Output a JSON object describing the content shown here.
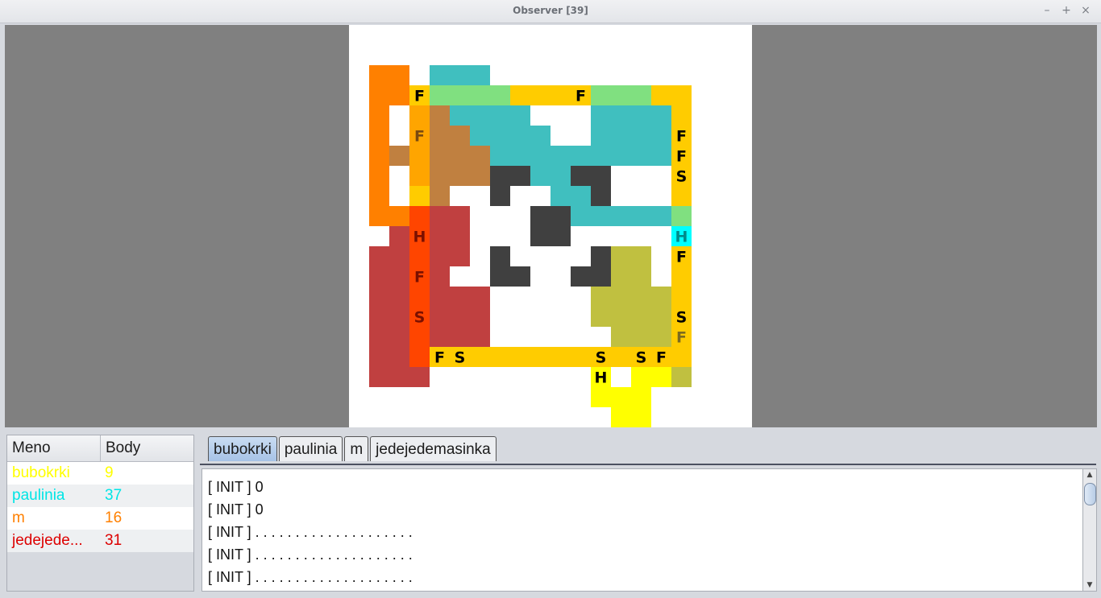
{
  "window": {
    "title": "Observer [39]",
    "buttons": {
      "minimize": "–",
      "maximize": "+",
      "close": "×"
    }
  },
  "scoreboard": {
    "headers": {
      "name": "Meno",
      "points": "Body"
    },
    "rows": [
      {
        "name": "bubokrki",
        "points": "9",
        "color": "#ffff00"
      },
      {
        "name": "paulinia",
        "points": "37",
        "color": "#00e5e5"
      },
      {
        "name": "m",
        "points": "16",
        "color": "#ff8000"
      },
      {
        "name": "jedejede...",
        "points": "31",
        "color": "#dd0000"
      }
    ]
  },
  "tabs": [
    "bubokrki",
    "paulinia",
    "m",
    "jedejedemasinka"
  ],
  "active_tab": "bubokrki",
  "log_lines": [
    "[ INIT ] 0",
    "[ INIT ] 0",
    "[ INIT ] . . . . . . . . . . . . . . . . . . . .",
    "[ INIT ] . . . . . . . . . . . . . . . . . . . .",
    "[ INIT ] . . . . . . . . . . . . . . . . . . . ."
  ],
  "board": {
    "grid_size": 20,
    "colors": {
      "orange": "#ff8000",
      "teal": "#40bfbf",
      "light_green": "#80e080",
      "gold": "#ffcc00",
      "amber": "#ffa500",
      "brown": "#c08040",
      "dark": "#404040",
      "red": "#c04040",
      "red_orange": "#ff4500",
      "olive": "#c0c040",
      "cyan": "#00ffff",
      "yellow": "#ffff00"
    },
    "cells": [
      [
        "orange",
        1,
        2
      ],
      [
        "orange",
        1,
        3
      ],
      [
        "orange",
        1,
        4
      ],
      [
        "orange",
        1,
        5
      ],
      [
        "orange",
        1,
        6
      ],
      [
        "orange",
        1,
        7
      ],
      [
        "orange",
        1,
        8
      ],
      [
        "orange",
        1,
        9
      ],
      [
        "orange",
        2,
        2
      ],
      [
        "orange",
        2,
        3
      ],
      [
        "orange",
        2,
        9
      ],
      [
        "orange",
        3,
        9
      ],
      [
        "teal",
        4,
        2
      ],
      [
        "teal",
        5,
        2
      ],
      [
        "teal",
        6,
        2
      ],
      [
        "gold",
        3,
        3
      ],
      [
        "light_green",
        4,
        3
      ],
      [
        "light_green",
        5,
        3
      ],
      [
        "light_green",
        6,
        3
      ],
      [
        "light_green",
        7,
        3
      ],
      [
        "gold",
        8,
        3
      ],
      [
        "gold",
        9,
        3
      ],
      [
        "gold",
        10,
        3
      ],
      [
        "gold",
        11,
        3
      ],
      [
        "light_green",
        12,
        3
      ],
      [
        "light_green",
        13,
        3
      ],
      [
        "light_green",
        14,
        3
      ],
      [
        "gold",
        15,
        3
      ],
      [
        "gold",
        16,
        3
      ],
      [
        "amber",
        3,
        4
      ],
      [
        "amber",
        3,
        5
      ],
      [
        "amber",
        3,
        6
      ],
      [
        "amber",
        3,
        7
      ],
      [
        "gold",
        3,
        8
      ],
      [
        "brown",
        2,
        6
      ],
      [
        "brown",
        4,
        4
      ],
      [
        "brown",
        4,
        5
      ],
      [
        "brown",
        5,
        5
      ],
      [
        "brown",
        4,
        6
      ],
      [
        "brown",
        5,
        6
      ],
      [
        "brown",
        6,
        6
      ],
      [
        "brown",
        4,
        7
      ],
      [
        "brown",
        5,
        7
      ],
      [
        "brown",
        6,
        7
      ],
      [
        "brown",
        4,
        8
      ],
      [
        "teal",
        5,
        4
      ],
      [
        "teal",
        6,
        4
      ],
      [
        "teal",
        7,
        4
      ],
      [
        "teal",
        8,
        4
      ],
      [
        "teal",
        6,
        5
      ],
      [
        "teal",
        7,
        5
      ],
      [
        "teal",
        8,
        5
      ],
      [
        "teal",
        9,
        5
      ],
      [
        "teal",
        7,
        6
      ],
      [
        "teal",
        8,
        6
      ],
      [
        "teal",
        9,
        6
      ],
      [
        "teal",
        10,
        6
      ],
      [
        "teal",
        11,
        6
      ],
      [
        "teal",
        12,
        6
      ],
      [
        "teal",
        9,
        7
      ],
      [
        "teal",
        10,
        7
      ],
      [
        "teal",
        10,
        8
      ],
      [
        "teal",
        11,
        8
      ],
      [
        "teal",
        11,
        9
      ],
      [
        "teal",
        12,
        9
      ],
      [
        "teal",
        13,
        9
      ],
      [
        "teal",
        14,
        9
      ],
      [
        "teal",
        15,
        9
      ],
      [
        "teal",
        12,
        4
      ],
      [
        "teal",
        13,
        4
      ],
      [
        "teal",
        14,
        4
      ],
      [
        "teal",
        15,
        4
      ],
      [
        "teal",
        12,
        5
      ],
      [
        "teal",
        13,
        5
      ],
      [
        "teal",
        14,
        5
      ],
      [
        "teal",
        15,
        5
      ],
      [
        "teal",
        13,
        6
      ],
      [
        "teal",
        14,
        6
      ],
      [
        "teal",
        15,
        6
      ],
      [
        "gold",
        16,
        4
      ],
      [
        "gold",
        16,
        5
      ],
      [
        "gold",
        16,
        6
      ],
      [
        "gold",
        16,
        7
      ],
      [
        "gold",
        16,
        8
      ],
      [
        "light_green",
        16,
        9
      ],
      [
        "cyan",
        16,
        10
      ],
      [
        "gold",
        16,
        11
      ],
      [
        "gold",
        16,
        12
      ],
      [
        "gold",
        16,
        13
      ],
      [
        "gold",
        16,
        14
      ],
      [
        "gold",
        16,
        15
      ],
      [
        "gold",
        16,
        16
      ],
      [
        "olive",
        16,
        17
      ],
      [
        "dark",
        7,
        7
      ],
      [
        "dark",
        8,
        7
      ],
      [
        "dark",
        7,
        8
      ],
      [
        "dark",
        11,
        7
      ],
      [
        "dark",
        12,
        7
      ],
      [
        "dark",
        12,
        8
      ],
      [
        "dark",
        9,
        9
      ],
      [
        "dark",
        10,
        9
      ],
      [
        "dark",
        9,
        10
      ],
      [
        "dark",
        10,
        10
      ],
      [
        "dark",
        7,
        11
      ],
      [
        "dark",
        7,
        12
      ],
      [
        "dark",
        8,
        12
      ],
      [
        "dark",
        12,
        11
      ],
      [
        "dark",
        11,
        12
      ],
      [
        "dark",
        12,
        12
      ],
      [
        "red_orange",
        3,
        9
      ],
      [
        "red_orange",
        3,
        10
      ],
      [
        "red_orange",
        3,
        11
      ],
      [
        "red_orange",
        3,
        12
      ],
      [
        "red_orange",
        3,
        13
      ],
      [
        "red_orange",
        3,
        14
      ],
      [
        "red_orange",
        3,
        15
      ],
      [
        "red_orange",
        3,
        16
      ],
      [
        "red",
        4,
        9
      ],
      [
        "red",
        5,
        9
      ],
      [
        "red",
        4,
        10
      ],
      [
        "red",
        5,
        10
      ],
      [
        "red",
        4,
        11
      ],
      [
        "red",
        5,
        11
      ],
      [
        "red",
        2,
        10
      ],
      [
        "red",
        1,
        11
      ],
      [
        "red",
        2,
        11
      ],
      [
        "red",
        1,
        12
      ],
      [
        "red",
        2,
        12
      ],
      [
        "red",
        1,
        13
      ],
      [
        "red",
        2,
        13
      ],
      [
        "red",
        1,
        14
      ],
      [
        "red",
        2,
        14
      ],
      [
        "red",
        1,
        15
      ],
      [
        "red",
        2,
        15
      ],
      [
        "red",
        1,
        16
      ],
      [
        "red",
        2,
        16
      ],
      [
        "red",
        1,
        17
      ],
      [
        "red",
        2,
        17
      ],
      [
        "red",
        3,
        17
      ],
      [
        "red",
        4,
        12
      ],
      [
        "red",
        4,
        13
      ],
      [
        "red",
        5,
        13
      ],
      [
        "red",
        6,
        13
      ],
      [
        "red",
        4,
        14
      ],
      [
        "red",
        5,
        14
      ],
      [
        "red",
        6,
        14
      ],
      [
        "red",
        4,
        15
      ],
      [
        "red",
        5,
        15
      ],
      [
        "red",
        6,
        15
      ],
      [
        "gold",
        4,
        16
      ],
      [
        "gold",
        5,
        16
      ],
      [
        "gold",
        6,
        16
      ],
      [
        "gold",
        7,
        16
      ],
      [
        "gold",
        8,
        16
      ],
      [
        "gold",
        9,
        16
      ],
      [
        "gold",
        10,
        16
      ],
      [
        "gold",
        11,
        16
      ],
      [
        "gold",
        12,
        16
      ],
      [
        "gold",
        13,
        16
      ],
      [
        "gold",
        14,
        16
      ],
      [
        "gold",
        15,
        16
      ],
      [
        "olive",
        13,
        11
      ],
      [
        "olive",
        14,
        11
      ],
      [
        "olive",
        13,
        12
      ],
      [
        "olive",
        14,
        12
      ],
      [
        "olive",
        12,
        13
      ],
      [
        "olive",
        13,
        13
      ],
      [
        "olive",
        14,
        13
      ],
      [
        "olive",
        15,
        13
      ],
      [
        "olive",
        12,
        14
      ],
      [
        "olive",
        13,
        14
      ],
      [
        "olive",
        14,
        14
      ],
      [
        "olive",
        15,
        14
      ],
      [
        "olive",
        13,
        15
      ],
      [
        "olive",
        14,
        15
      ],
      [
        "olive",
        15,
        15
      ],
      [
        "yellow",
        12,
        17
      ],
      [
        "yellow",
        14,
        17
      ],
      [
        "yellow",
        15,
        17
      ],
      [
        "yellow",
        12,
        18
      ],
      [
        "yellow",
        13,
        18
      ],
      [
        "yellow",
        14,
        18
      ],
      [
        "yellow",
        13,
        19
      ],
      [
        "yellow",
        14,
        19
      ]
    ],
    "labels": [
      [
        "F",
        3,
        3,
        "#000000"
      ],
      [
        "F",
        11,
        3,
        "#000000"
      ],
      [
        "F",
        3,
        5,
        "#7a4a10"
      ],
      [
        "F",
        16,
        5,
        "#000000"
      ],
      [
        "F",
        16,
        6,
        "#000000"
      ],
      [
        "S",
        16,
        7,
        "#000000"
      ],
      [
        "H",
        3,
        10,
        "#7a1000"
      ],
      [
        "H",
        16,
        10,
        "#008a8a"
      ],
      [
        "F",
        16,
        11,
        "#000000"
      ],
      [
        "F",
        3,
        12,
        "#7a1000"
      ],
      [
        "S",
        3,
        14,
        "#7a1000"
      ],
      [
        "S",
        16,
        14,
        "#000000"
      ],
      [
        "F",
        16,
        15,
        "#7a6a20"
      ],
      [
        "F",
        4,
        16,
        "#000000"
      ],
      [
        "S",
        5,
        16,
        "#000000"
      ],
      [
        "S",
        12,
        16,
        "#000000"
      ],
      [
        "S",
        14,
        16,
        "#000000"
      ],
      [
        "F",
        15,
        16,
        "#000000"
      ],
      [
        "H",
        12,
        17,
        "#000000"
      ]
    ]
  }
}
